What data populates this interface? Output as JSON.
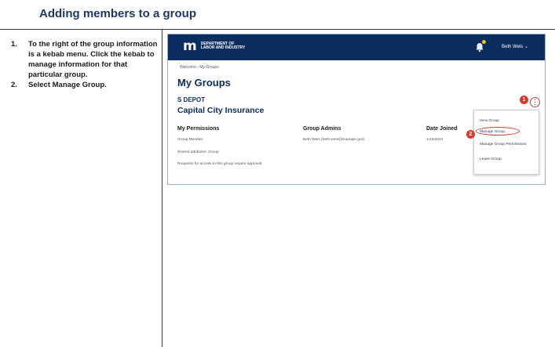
{
  "document": {
    "title": "Adding members to a group",
    "steps": [
      {
        "number": "1.",
        "text": "To the right of the group information is a kebab menu. Click the kebab to manage information for that particular group."
      },
      {
        "number": "2.",
        "text_before": "Select ",
        "text_strong": "Manage Group",
        "text_after": "."
      }
    ]
  },
  "screenshot": {
    "logo": {
      "mark": "m",
      "line1": "DEPARTMENT OF",
      "line2": "LABOR AND INDUSTRY"
    },
    "user_name": "Beth Weis ⌄",
    "breadcrumb": "Welcome › My Groups",
    "page_title": "My Groups",
    "group_code": "S DEPOT",
    "group_name": "Capital City Insurance",
    "columns": {
      "permissions": "My Permissions",
      "admins": "Group Admins",
      "date_joined": "Date Joined"
    },
    "row": {
      "permission": "Group Member",
      "admin": "Beth Weis (beth.weis@example.gov)",
      "date": "1/16/2024"
    },
    "notes": [
      "Shared attributes: Group",
      "Requests for access to this group require approval"
    ],
    "menu": {
      "items": [
        "View Group",
        "Manage Group",
        "Manage Group Permissions",
        "Leave Group"
      ]
    },
    "badges": [
      "1",
      "2"
    ],
    "kebab_glyph": "⋮",
    "colors": {
      "header": "#0b2c5f",
      "accent": "#d43b2f",
      "title": "#1f3864"
    }
  }
}
